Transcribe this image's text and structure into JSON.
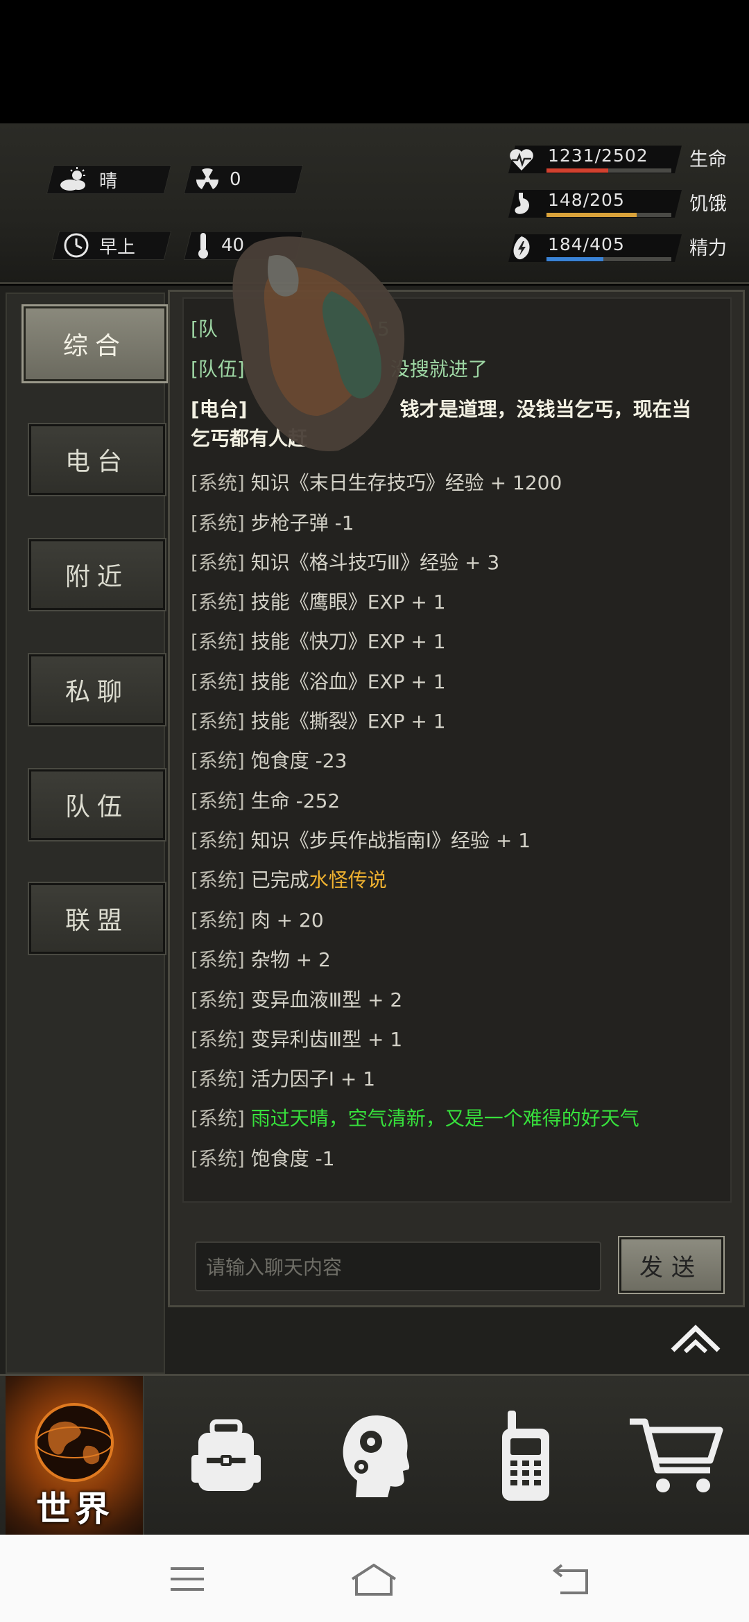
{
  "hud": {
    "weather": "晴",
    "radiation": "0",
    "time_of_day": "早上",
    "temperature": "40",
    "stats": [
      {
        "name": "生命",
        "value": "1231/2502",
        "ratio": 0.492,
        "color": "#d2412f",
        "icon": "heart-icon"
      },
      {
        "name": "饥饿",
        "value": "148/205",
        "ratio": 0.722,
        "color": "#d9a23a",
        "icon": "stomach-icon"
      },
      {
        "name": "精力",
        "value": "184/405",
        "ratio": 0.454,
        "color": "#3a83d6",
        "icon": "energy-icon"
      }
    ]
  },
  "tabs": [
    {
      "label": "综合",
      "active": true
    },
    {
      "label": "电台",
      "active": false
    },
    {
      "label": "附近",
      "active": false
    },
    {
      "label": "私聊",
      "active": false
    },
    {
      "label": "队伍",
      "active": false
    },
    {
      "label": "联盟",
      "active": false
    }
  ],
  "chat": {
    "lines": [
      {
        "tag": "[队",
        "text": "5",
        "kind": "team"
      },
      {
        "tag": "[队伍]",
        "text": "没搜就进了",
        "kind": "team"
      },
      {
        "tag": "[电台]",
        "text": "钱才是道理，没钱当乞丐，现在当",
        "kind": "radio"
      },
      {
        "tag": "",
        "text": "乞丐都有人赶",
        "kind": "radio"
      },
      {
        "tag": "[系统]",
        "text": "知识《末日生存技巧》经验 + 1200",
        "kind": "system"
      },
      {
        "tag": "[系统]",
        "text": "步枪子弹 -1",
        "kind": "system"
      },
      {
        "tag": "[系统]",
        "text": "知识《格斗技巧Ⅲ》经验 + 3",
        "kind": "system"
      },
      {
        "tag": "[系统]",
        "text": "技能《鹰眼》EXP + 1",
        "kind": "system"
      },
      {
        "tag": "[系统]",
        "text": "技能《快刀》EXP + 1",
        "kind": "system"
      },
      {
        "tag": "[系统]",
        "text": "技能《浴血》EXP + 1",
        "kind": "system"
      },
      {
        "tag": "[系统]",
        "text": "技能《撕裂》EXP + 1",
        "kind": "system"
      },
      {
        "tag": "[系统]",
        "text": "饱食度 -23",
        "kind": "system"
      },
      {
        "tag": "[系统]",
        "text": "生命 -252",
        "kind": "system"
      },
      {
        "tag": "[系统]",
        "text": "知识《步兵作战指南Ⅰ》经验 + 1",
        "kind": "system"
      },
      {
        "tag": "[系统]",
        "text": "已完成",
        "extra": "水怪传说",
        "kind": "system-quest"
      },
      {
        "tag": "[系统]",
        "text": "肉 + 20",
        "kind": "system"
      },
      {
        "tag": "[系统]",
        "text": "杂物 + 2",
        "kind": "system"
      },
      {
        "tag": "[系统]",
        "text": "变异血液Ⅲ型 + 2",
        "kind": "system"
      },
      {
        "tag": "[系统]",
        "text": "变异利齿Ⅲ型 + 1",
        "kind": "system"
      },
      {
        "tag": "[系统]",
        "text": "活力因子Ⅰ + 1",
        "kind": "system"
      },
      {
        "tag": "[系统]",
        "text": "雨过天晴，空气清新，又是一个难得的好天气",
        "kind": "green"
      },
      {
        "tag": "[系统]",
        "text": "饱食度 -1",
        "kind": "system"
      }
    ],
    "input_placeholder": "请输入聊天内容",
    "send_label": "发送"
  },
  "bottom_nav": [
    {
      "label": "世界",
      "icon": "globe-icon",
      "active": true
    },
    {
      "label": "",
      "icon": "backpack-icon",
      "active": false
    },
    {
      "label": "",
      "icon": "head-gears-icon",
      "active": false
    },
    {
      "label": "",
      "icon": "walkie-talkie-icon",
      "active": false
    },
    {
      "label": "",
      "icon": "shopping-cart-icon",
      "active": false
    }
  ]
}
